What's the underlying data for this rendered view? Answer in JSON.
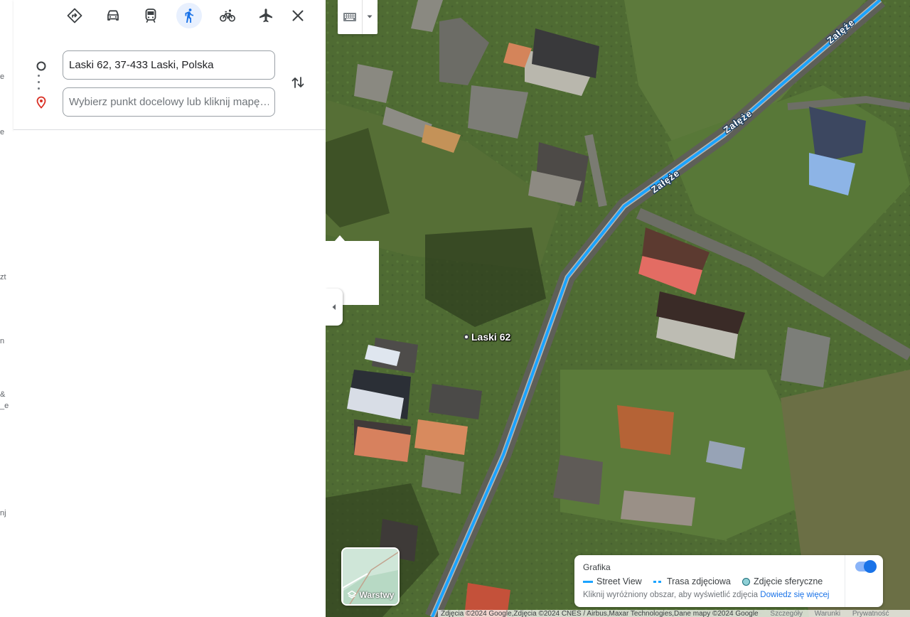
{
  "travel_modes": [
    {
      "name": "best",
      "icon": "directions-diamond-icon",
      "active": false
    },
    {
      "name": "driving",
      "icon": "car-icon",
      "active": false
    },
    {
      "name": "transit",
      "icon": "train-icon",
      "active": false
    },
    {
      "name": "walking",
      "icon": "walking-icon",
      "active": true
    },
    {
      "name": "cycling",
      "icon": "bicycle-icon",
      "active": false
    },
    {
      "name": "flights",
      "icon": "airplane-icon",
      "active": false
    }
  ],
  "directions": {
    "origin_value": "Laski 62, 37-433 Laski, Polska",
    "destination_value": "",
    "destination_placeholder": "Wybierz punkt docelowy lub kliknij mapę…"
  },
  "left_strip_fragments": [
    "e",
    "e",
    "zt",
    "n",
    "&",
    "_e",
    "nj"
  ],
  "map": {
    "road_name": "Załęże",
    "place_label": "Laski 62",
    "route_color": "#1aa3ff",
    "layers_label": "Warstwy"
  },
  "legend": {
    "title": "Grafika",
    "street_view": "Street View",
    "photo_path": "Trasa zdjęciowa",
    "spherical_photo": "Zdjęcie sferyczne",
    "note": "Kliknij wyróżniony obszar, aby wyświetlić zdjęcia",
    "learn_more": "Dowiedz się więcej",
    "toggle_on": true
  },
  "attribution": {
    "text": "Zdjęcia ©2024 Google,Zdjęcia ©2024 CNES / Airbus,Maxar Technologies,Dane mapy ©2024 Google",
    "links": [
      "Szczegóły",
      "Warunki",
      "Prywatność"
    ]
  }
}
